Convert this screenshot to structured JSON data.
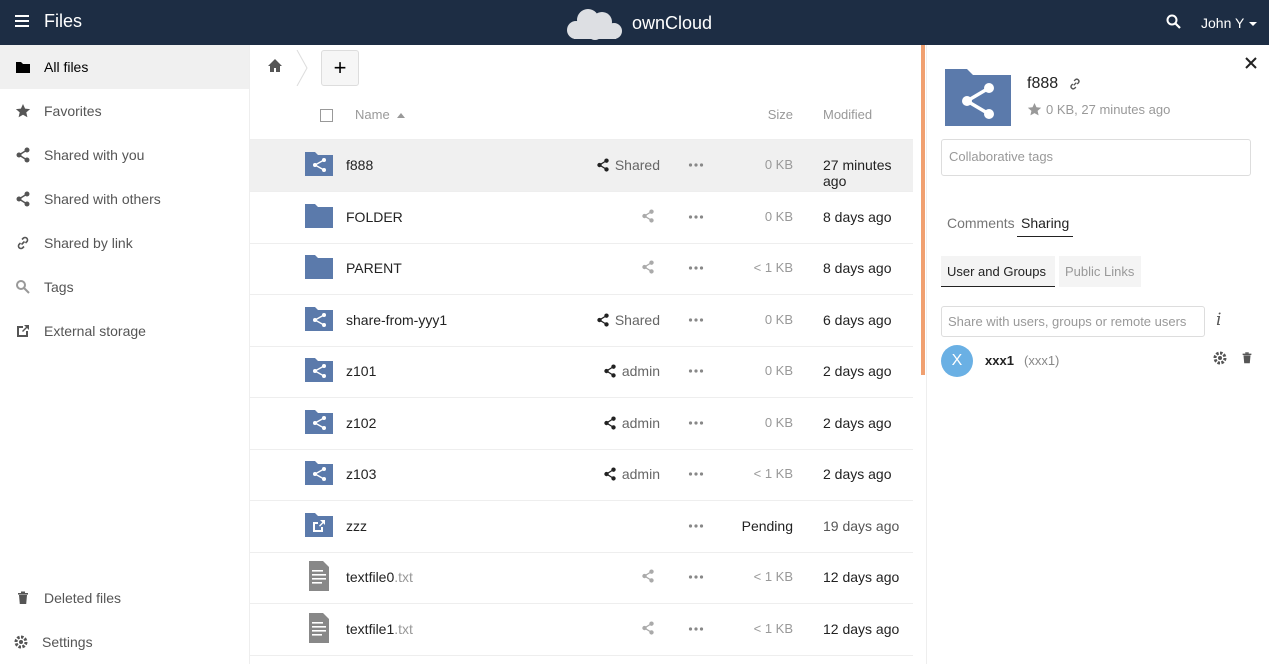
{
  "header": {
    "app_title": "Files",
    "brand": "ownCloud",
    "user": "John Y"
  },
  "sidebar": {
    "items": [
      {
        "label": "All files",
        "icon": "folder-icon"
      },
      {
        "label": "Favorites",
        "icon": "star-icon"
      },
      {
        "label": "Shared with you",
        "icon": "share-icon"
      },
      {
        "label": "Shared with others",
        "icon": "share-icon"
      },
      {
        "label": "Shared by link",
        "icon": "link-icon"
      },
      {
        "label": "Tags",
        "icon": "tag-search-icon"
      },
      {
        "label": "External storage",
        "icon": "external-icon"
      }
    ],
    "bottom_items": [
      {
        "label": "Deleted files",
        "icon": "trash-icon"
      },
      {
        "label": "Settings",
        "icon": "gear-icon"
      }
    ]
  },
  "controls": {
    "new_label": "+"
  },
  "list": {
    "headers": {
      "name": "Name",
      "size": "Size",
      "modified": "Modified"
    },
    "rows": [
      {
        "name": "f888",
        "ext": "",
        "share": "Shared",
        "size": "0 KB",
        "modified": "27 minutes ago",
        "type": "shared-folder"
      },
      {
        "name": "FOLDER",
        "ext": "",
        "share": "",
        "size": "0 KB",
        "modified": "8 days ago",
        "type": "folder"
      },
      {
        "name": "PARENT",
        "ext": "",
        "share": "",
        "size": "< 1 KB",
        "modified": "8 days ago",
        "type": "folder"
      },
      {
        "name": "share-from-yyy1",
        "ext": "",
        "share": "Shared",
        "size": "0 KB",
        "modified": "6 days ago",
        "type": "shared-folder"
      },
      {
        "name": "z101",
        "ext": "",
        "share": "admin",
        "size": "0 KB",
        "modified": "2 days ago",
        "type": "shared-folder"
      },
      {
        "name": "z102",
        "ext": "",
        "share": "admin",
        "size": "0 KB",
        "modified": "2 days ago",
        "type": "shared-folder"
      },
      {
        "name": "z103",
        "ext": "",
        "share": "admin",
        "size": "< 1 KB",
        "modified": "2 days ago",
        "type": "shared-folder"
      },
      {
        "name": "zzz",
        "ext": "",
        "share": "",
        "size": "Pending",
        "modified": "19 days ago",
        "type": "external-folder"
      },
      {
        "name": "textfile0",
        "ext": ".txt",
        "share": "",
        "size": "< 1 KB",
        "modified": "12 days ago",
        "type": "text-file"
      },
      {
        "name": "textfile1",
        "ext": ".txt",
        "share": "",
        "size": "< 1 KB",
        "modified": "12 days ago",
        "type": "text-file"
      }
    ]
  },
  "details": {
    "name": "f888",
    "meta": "0 KB, 27 minutes ago",
    "tags_placeholder": "Collaborative tags",
    "tabs": [
      "Comments",
      "Sharing"
    ],
    "subtabs": [
      "User and Groups",
      "Public Links"
    ],
    "share_placeholder": "Share with users, groups or remote users",
    "info_glyph": "i",
    "sharee": {
      "avatar_letter": "X",
      "name": "xxx1",
      "id": "(xxx1)"
    }
  },
  "colors": {
    "header_bg": "#1d2d44",
    "folder": "#5b7aab",
    "accent_scroll": "#f0a070",
    "avatar": "#6ab0e4"
  }
}
